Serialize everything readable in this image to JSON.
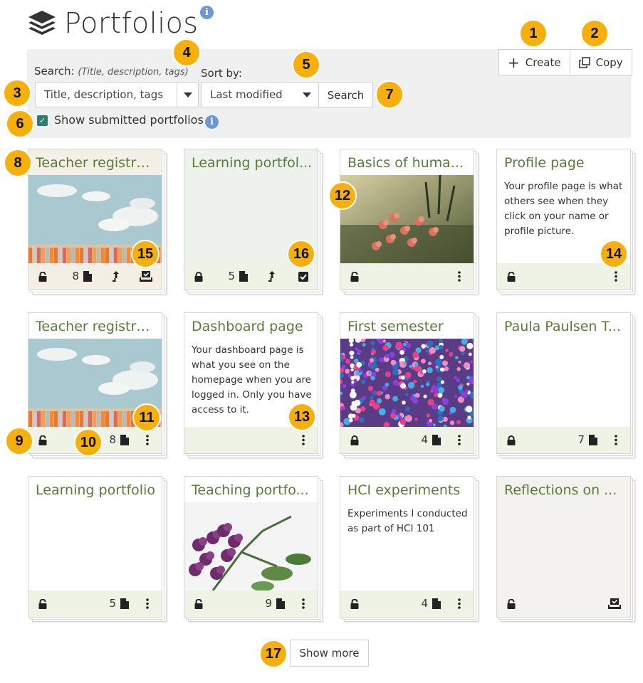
{
  "header": {
    "title": "Portfolios",
    "info": "i"
  },
  "toolbar": {
    "create_label": "Create",
    "copy_label": "Copy"
  },
  "filters": {
    "search_label": "Search:",
    "search_hint": "(Title, description, tags)",
    "search_selected": "Title, description, tags",
    "sort_label": "Sort by:",
    "sort_selected": "Last modified",
    "search_button": "Search",
    "show_submitted_label": "Show submitted portfolios",
    "show_submitted_checked": true
  },
  "cards": [
    {
      "title": "Teacher registra...",
      "desc": "",
      "image": "sky",
      "count": "8",
      "lock": "unlocked",
      "actions": [
        "submit-arrow-icon",
        "submitted-tray-icon"
      ],
      "tint": "beige"
    },
    {
      "title": "Learning portfol...",
      "desc": "",
      "image": "",
      "count": "5",
      "lock": "locked",
      "actions": [
        "submit-arrow-icon",
        "checkbox-icon"
      ],
      "tint": "green"
    },
    {
      "title": "Basics of huma...",
      "desc": "",
      "image": "flowers",
      "count": "",
      "lock": "unlocked",
      "actions": [
        "kebab-icon"
      ],
      "tint": ""
    },
    {
      "title": "Profile page",
      "desc": "Your profile page is what others see when they click on your name or profile picture.",
      "image": "",
      "count": "",
      "lock": "unlocked",
      "actions": [
        "kebab-icon"
      ],
      "tint": ""
    },
    {
      "title": "Teacher registra...",
      "desc": "",
      "image": "sky",
      "count": "8",
      "lock": "unlocked",
      "actions": [
        "kebab-icon"
      ],
      "tint": ""
    },
    {
      "title": "Dashboard page",
      "desc": "Your dashboard page is what you see on the homepage when you are logged in. Only you have access to it.",
      "image": "",
      "count": "",
      "lock": "",
      "actions": [
        "kebab-icon"
      ],
      "tint": ""
    },
    {
      "title": "First semester",
      "desc": "",
      "image": "sprinkles",
      "count": "4",
      "lock": "locked",
      "actions": [
        "kebab-icon"
      ],
      "tint": ""
    },
    {
      "title": "Paula Paulsen T...",
      "desc": "",
      "image": "",
      "count": "7",
      "lock": "locked",
      "actions": [
        "kebab-icon"
      ],
      "tint": ""
    },
    {
      "title": "Learning portfolio",
      "desc": "",
      "image": "",
      "count": "5",
      "lock": "unlocked",
      "actions": [
        "kebab-icon"
      ],
      "tint": ""
    },
    {
      "title": "Teaching portfo...",
      "desc": "",
      "image": "lilac",
      "count": "9",
      "lock": "unlocked",
      "actions": [
        "kebab-icon"
      ],
      "tint": ""
    },
    {
      "title": "HCI experiments",
      "desc": "Experiments I conducted as part of HCI 101",
      "image": "",
      "count": "4",
      "lock": "unlocked",
      "actions": [
        "kebab-icon"
      ],
      "tint": ""
    },
    {
      "title": "Reflections on ...",
      "desc": "",
      "image": "",
      "count": "",
      "lock": "unlocked",
      "actions": [
        "submitted-tray-icon"
      ],
      "tint": "beige-plain"
    }
  ],
  "show_more_label": "Show more",
  "callouts": [
    "1",
    "2",
    "3",
    "4",
    "5",
    "6",
    "7",
    "8",
    "9",
    "10",
    "11",
    "12",
    "13",
    "14",
    "15",
    "16",
    "17"
  ],
  "colors": {
    "title_green": "#5a7a3a",
    "footer_bg": "#eef3e6",
    "callout": "#f6b00e",
    "panel_bg": "#f0f0f0"
  }
}
